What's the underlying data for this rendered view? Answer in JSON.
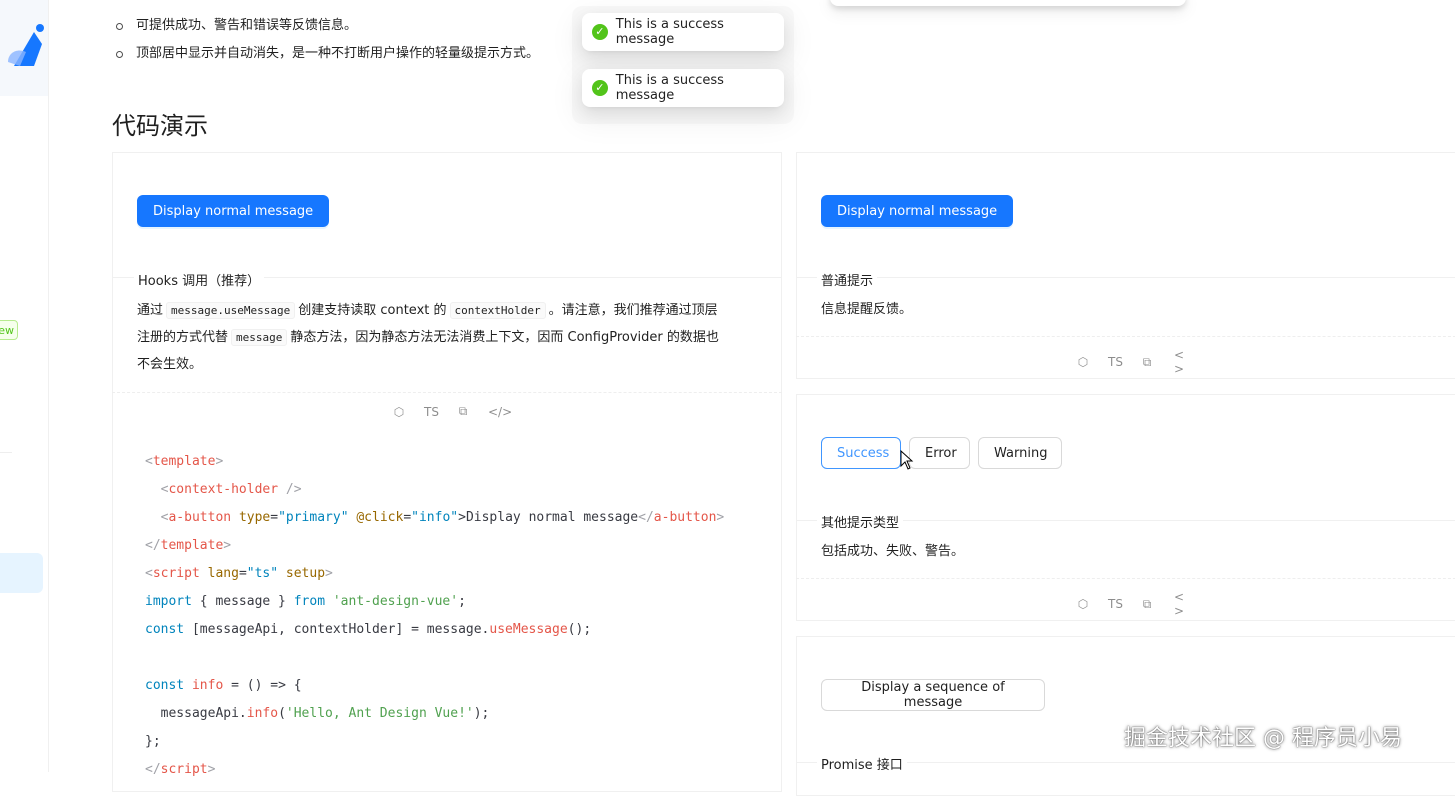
{
  "sidebar": {
    "badge": "ew"
  },
  "bullets": [
    "可提供成功、警告和错误等反馈信息。",
    "顶部居中显示并自动消失，是一种不打断用户操作的轻量级提示方式。"
  ],
  "section_title": "代码演示",
  "toasts": [
    {
      "text": "This is a success message"
    },
    {
      "text": "This is a success message"
    }
  ],
  "demo_left": {
    "button": "Display normal message",
    "meta_title": "Hooks 调用（推荐）",
    "desc": {
      "p1": "通过",
      "c1": "message.useMessage",
      "p2": "创建支持读取 context 的",
      "c2": "contextHolder",
      "p3": "。请注意，我们推荐通过顶层",
      "p4": "注册的方式代替",
      "c3": "message",
      "p5": "静态方法，因为静态方法无法消费上下文，因而 ConfigProvider 的数据也",
      "p6": "不会生效。"
    },
    "actions": {
      "sandbox": "codesandbox-icon",
      "ts": "TS",
      "copy": "copy-icon",
      "code": "</>"
    }
  },
  "demo_normal": {
    "button": "Display normal message",
    "meta_title": "普通提示",
    "desc": "信息提醒反馈。",
    "actions": {
      "ts": "TS",
      "code": "< >"
    }
  },
  "demo_types": {
    "buttons": [
      "Success",
      "Error",
      "Warning"
    ],
    "meta_title": "其他提示类型",
    "desc": "包括成功、失败、警告。",
    "actions": {
      "ts": "TS",
      "code": "< >"
    }
  },
  "demo_sequence": {
    "button": "Display a sequence of message",
    "meta_title": "Promise 接口"
  },
  "watermark": "掘金技术社区 @ 程序员小易",
  "colors": {
    "primary": "#1677ff",
    "success": "#52c41a"
  }
}
